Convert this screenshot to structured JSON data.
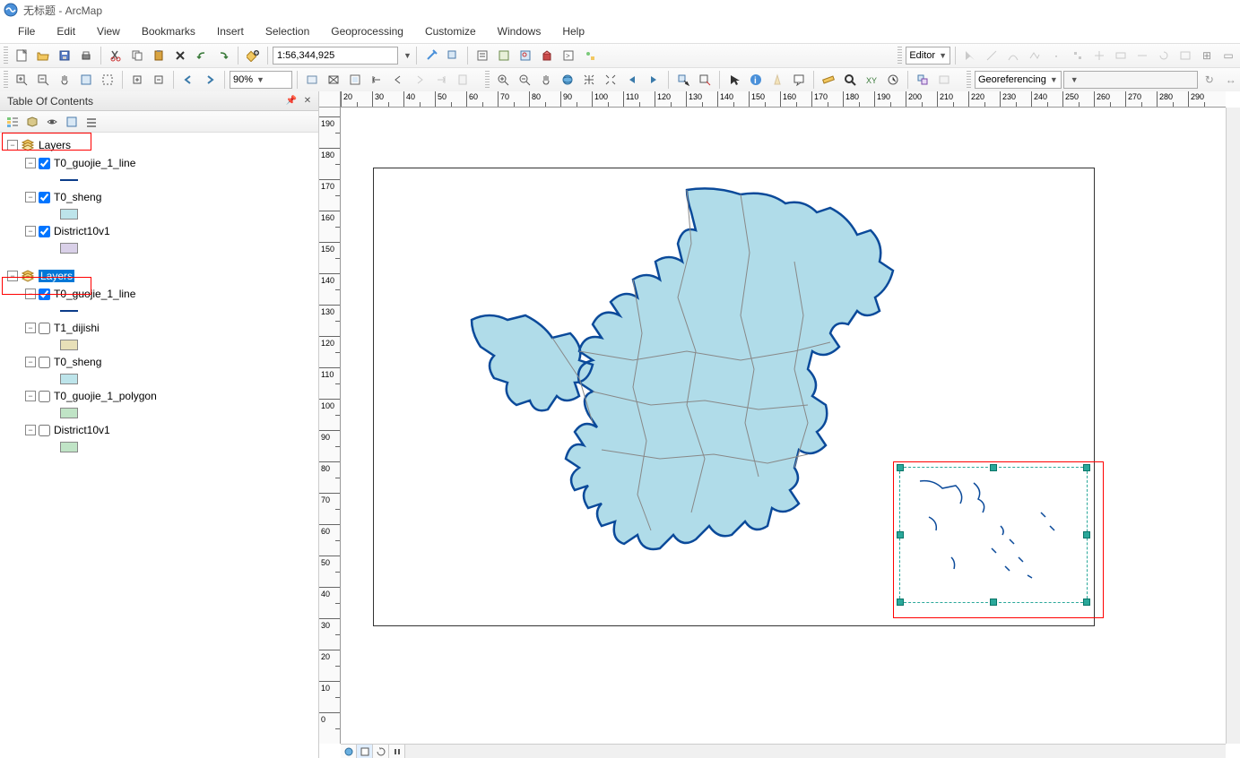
{
  "title": "无标题 - ArcMap",
  "menu": [
    "File",
    "Edit",
    "View",
    "Bookmarks",
    "Insert",
    "Selection",
    "Geoprocessing",
    "Customize",
    "Windows",
    "Help"
  ],
  "toolbar1": {
    "scale_value": "1:56,344,925",
    "editor_label": "Editor"
  },
  "toolbar2": {
    "zoom_pct": "90%",
    "georef_label": "Georeferencing"
  },
  "toc": {
    "title": "Table Of Contents",
    "frames": [
      {
        "label": "Layers",
        "selected": false,
        "layers": [
          {
            "name": "T0_guojie_1_line",
            "checked": true,
            "swatch_type": "line",
            "swatch_color": "#0b3c8a"
          },
          {
            "name": "T0_sheng",
            "checked": true,
            "swatch_type": "fill",
            "swatch_color": "#bde4ea"
          },
          {
            "name": "District10v1",
            "checked": true,
            "swatch_type": "fill",
            "swatch_color": "#d9d0e8"
          }
        ]
      },
      {
        "label": "Layers",
        "selected": true,
        "layers": [
          {
            "name": "T0_guojie_1_line",
            "checked": true,
            "swatch_type": "line",
            "swatch_color": "#0b3c8a"
          },
          {
            "name": "T1_dijishi",
            "checked": false,
            "swatch_type": "fill",
            "swatch_color": "#e8e0b8"
          },
          {
            "name": "T0_sheng",
            "checked": false,
            "swatch_type": "fill",
            "swatch_color": "#bde4ea"
          },
          {
            "name": "T0_guojie_1_polygon",
            "checked": false,
            "swatch_type": "fill",
            "swatch_color": "#c0e4c6"
          },
          {
            "name": "District10v1",
            "checked": false,
            "swatch_type": "fill",
            "swatch_color": "#c0e4c6"
          }
        ]
      }
    ]
  },
  "ruler_h": [
    "20",
    "30",
    "40",
    "50",
    "60",
    "70",
    "80",
    "90",
    "100",
    "110",
    "120",
    "130",
    "140",
    "150",
    "160",
    "170",
    "180",
    "190",
    "200",
    "210",
    "220",
    "230",
    "240",
    "250",
    "260",
    "270",
    "280",
    "290"
  ],
  "ruler_v": [
    "0",
    "10",
    "20",
    "30",
    "40",
    "50",
    "60",
    "70",
    "80",
    "90",
    "100",
    "110",
    "120",
    "130",
    "140",
    "150",
    "160",
    "170",
    "180",
    "190"
  ]
}
